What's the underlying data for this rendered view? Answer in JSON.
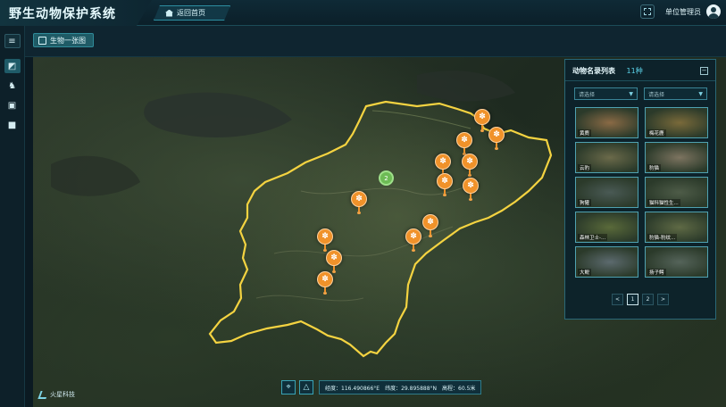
{
  "header": {
    "app_title": "野生动物保护系统",
    "home_tab": "返回首页",
    "user_name": "单位管理员"
  },
  "toolbar": {
    "map_tab": "生物一张图"
  },
  "map": {
    "cluster_label": "2",
    "brand": "火星科技",
    "coords": {
      "lng_label": "经度：",
      "lng_value": "116.490866°E",
      "lat_label": "纬度：",
      "lat_value": "29.895888°N",
      "alt_label": "高程：",
      "alt_value": "60.5米"
    }
  },
  "panel": {
    "title": "动物名录列表",
    "count": "11种",
    "filter_1": "请选择",
    "filter_2": "请选择",
    "species": [
      {
        "name": "黄麂",
        "color": "#8a6a45"
      },
      {
        "name": "梅花鹿",
        "color": "#7a6a3a"
      },
      {
        "name": "云豹",
        "color": "#6b6a4a"
      },
      {
        "name": "豹猫",
        "color": "#7d7460"
      },
      {
        "name": "狗獾",
        "color": "#4a5a55"
      },
      {
        "name": "猫科猫性生...",
        "color": "#4e5c48"
      },
      {
        "name": "森林卫士-...",
        "color": "#5a6a3a"
      },
      {
        "name": "豹猫-豹纹...",
        "color": "#5f6a45"
      },
      {
        "name": "大鲵",
        "color": "#5c6a6e"
      },
      {
        "name": "扬子鳄",
        "color": "#55645a"
      }
    ],
    "pages": [
      "1",
      "2"
    ],
    "prev": "<",
    "next": ">"
  }
}
